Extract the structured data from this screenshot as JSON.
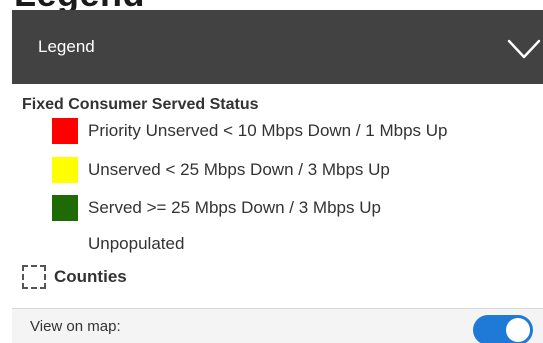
{
  "cut_title": "Legend",
  "legend": {
    "header_title": "Legend",
    "collapse_icon": "chevron-down-icon",
    "group_title": "Fixed Consumer Served Status",
    "items": [
      {
        "label": "Priority Unserved < 10 Mbps Down / 1 Mbps Up",
        "color": "#ff0000"
      },
      {
        "label": "Unserved < 25 Mbps Down / 3 Mbps Up",
        "color": "#ffff00"
      },
      {
        "label": "Served >= 25 Mbps Down / 3 Mbps Up",
        "color": "#1e6b05"
      },
      {
        "label": "Unpopulated",
        "color": ""
      }
    ],
    "counties_label": "Counties",
    "counties_checked": false
  },
  "footer": {
    "view_on_map_label": "View on map:",
    "toggle_on": true,
    "toggle_color": "#1e7ad6"
  }
}
